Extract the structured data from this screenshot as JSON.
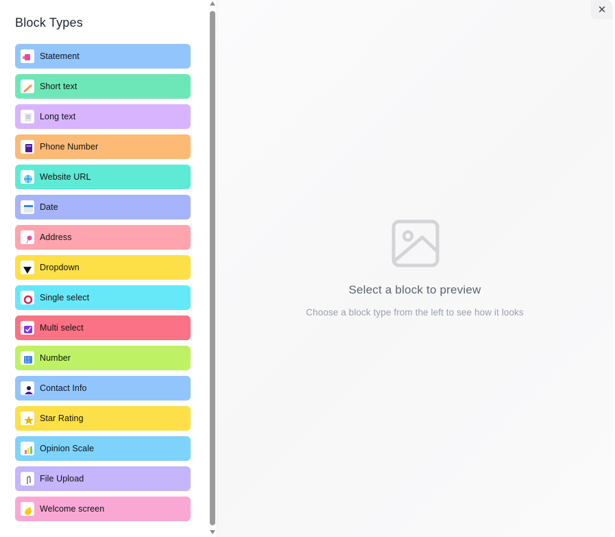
{
  "sidebar": {
    "title": "Block Types",
    "items": [
      {
        "label": "Statement",
        "color": "#93c5fd",
        "icon": "megaphone-icon"
      },
      {
        "label": "Short text",
        "color": "#6ee7b7",
        "icon": "pencil-icon"
      },
      {
        "label": "Long text",
        "color": "#d8b4fe",
        "icon": "document-icon"
      },
      {
        "label": "Phone Number",
        "color": "#fdba74",
        "icon": "calculator-icon"
      },
      {
        "label": "Website URL",
        "color": "#5eead4",
        "icon": "globe-icon"
      },
      {
        "label": "Date",
        "color": "#a5b4fc",
        "icon": "calendar-icon"
      },
      {
        "label": "Address",
        "color": "#fda4af",
        "icon": "pin-icon"
      },
      {
        "label": "Dropdown",
        "color": "#fde047",
        "icon": "triangle-down-icon"
      },
      {
        "label": "Single select",
        "color": "#67e8f9",
        "icon": "radio-icon"
      },
      {
        "label": "Multi select",
        "color": "#fb7185",
        "icon": "checkbox-icon"
      },
      {
        "label": "Number",
        "color": "#bef264",
        "icon": "numbers-icon"
      },
      {
        "label": "Contact Info",
        "color": "#93c5fd",
        "icon": "person-icon"
      },
      {
        "label": "Star Rating",
        "color": "#fde047",
        "icon": "star-icon"
      },
      {
        "label": "Opinion Scale",
        "color": "#7dd3fc",
        "icon": "bar-chart-icon"
      },
      {
        "label": "File Upload",
        "color": "#c4b5fd",
        "icon": "paperclip-icon"
      },
      {
        "label": "Welcome screen",
        "color": "#f9a8d4",
        "icon": "wave-hand-icon"
      }
    ]
  },
  "preview": {
    "icon": "image-placeholder-icon",
    "title": "Select a block to preview",
    "subtitle": "Choose a block type from the left to see how it looks"
  },
  "close": {
    "label": "✕",
    "icon": "close-icon"
  }
}
